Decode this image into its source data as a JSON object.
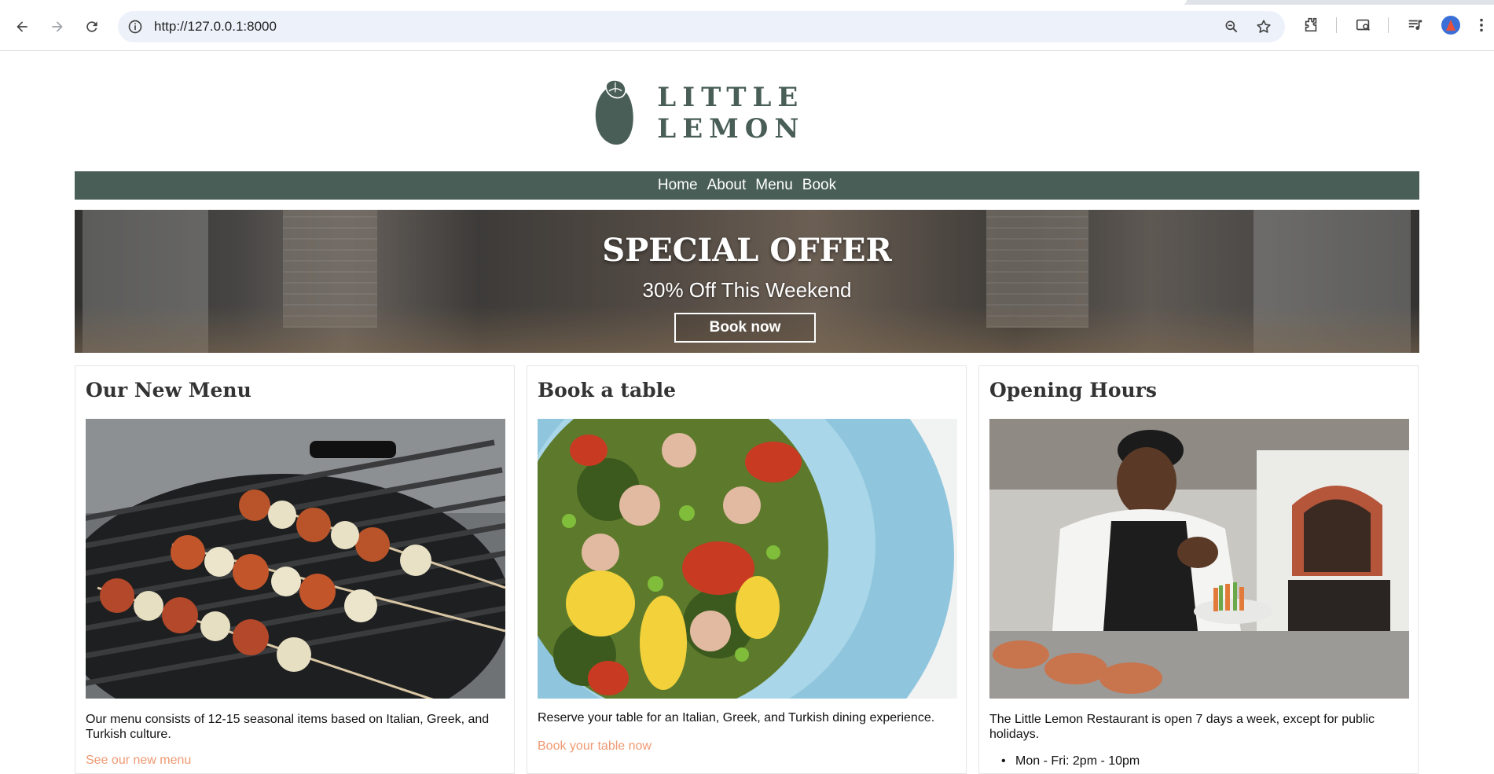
{
  "browser": {
    "url": "http://127.0.0.1:8000"
  },
  "site": {
    "brand_name": "LITTLE LEMON",
    "nav": [
      "Home",
      "About",
      "Menu",
      "Book"
    ]
  },
  "hero": {
    "title": "SPECIAL OFFER",
    "subtitle": "30% Off This Weekend",
    "button_label": "Book now"
  },
  "cards": [
    {
      "title": "Our New Menu",
      "text": "Our menu consists of 12-15 seasonal items based on Italian, Greek, and Turkish culture.",
      "link": "See our new menu"
    },
    {
      "title": "Book a table",
      "text": "Reserve your table for an Italian, Greek, and Turkish dining experience.",
      "link": "Book your table now"
    },
    {
      "title": "Opening Hours",
      "text": "The Little Lemon Restaurant is open 7 days a week, except for public holidays.",
      "hours": "Mon - Fri: 2pm - 10pm"
    }
  ],
  "colors": {
    "brand_green": "#495e57",
    "link_orange": "#ee9972"
  }
}
